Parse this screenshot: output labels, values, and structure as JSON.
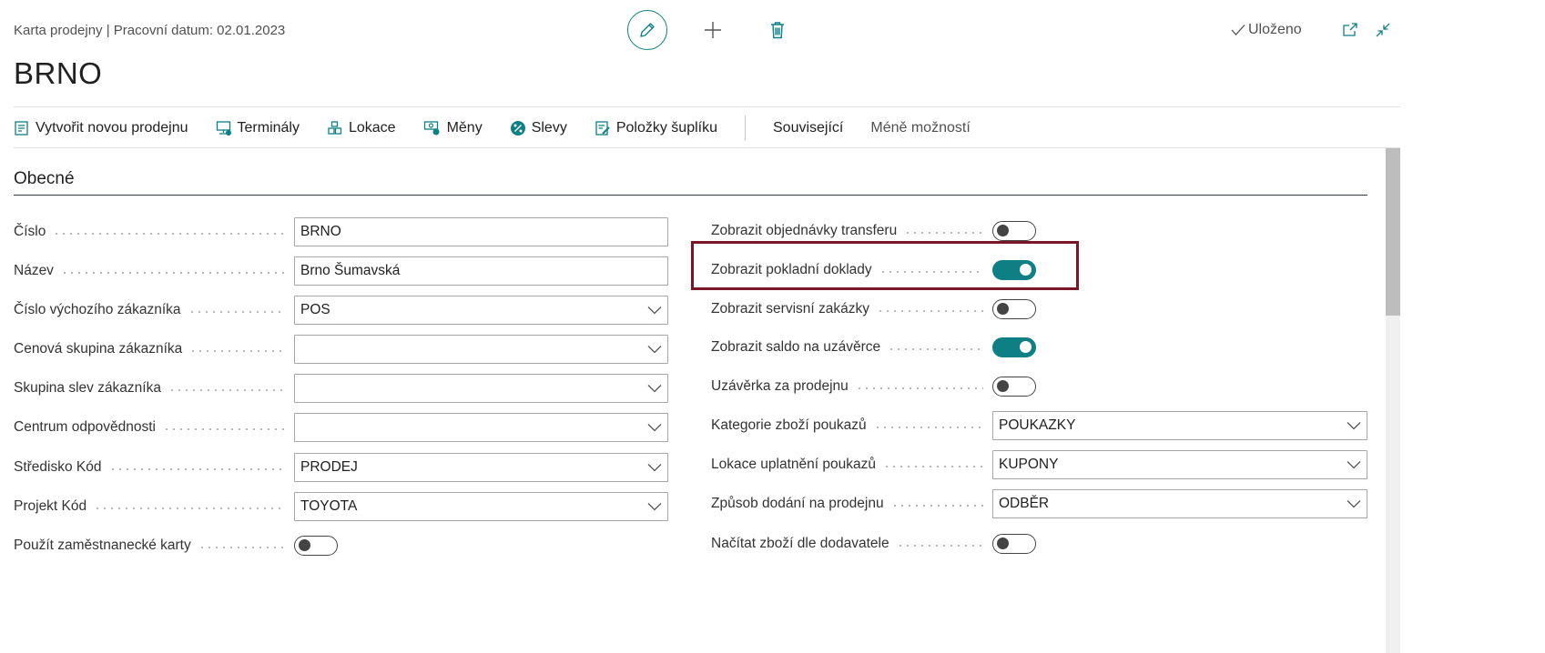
{
  "header": {
    "breadcrumb": "Karta prodejny | Pracovní datum: 02.01.2023",
    "title": "BRNO",
    "saved_label": "Uloženo"
  },
  "actions": [
    {
      "label": "Vytvořit novou prodejnu",
      "icon": "create-store-icon"
    },
    {
      "label": "Terminály",
      "icon": "terminal-icon"
    },
    {
      "label": "Lokace",
      "icon": "location-icon"
    },
    {
      "label": "Měny",
      "icon": "currency-icon"
    },
    {
      "label": "Slevy",
      "icon": "discount-icon"
    },
    {
      "label": "Položky šuplíku",
      "icon": "drawer-items-icon"
    }
  ],
  "more_actions": {
    "related": "Související",
    "fewer": "Méně možností"
  },
  "section": {
    "title": "Obecné"
  },
  "left_fields": [
    {
      "label": "Číslo",
      "type": "text",
      "value": "BRNO"
    },
    {
      "label": "Název",
      "type": "text",
      "value": "Brno Šumavská"
    },
    {
      "label": "Číslo výchozího zákazníka",
      "type": "select",
      "value": "POS"
    },
    {
      "label": "Cenová skupina zákazníka",
      "type": "select",
      "value": ""
    },
    {
      "label": "Skupina slev zákazníka",
      "type": "select",
      "value": ""
    },
    {
      "label": "Centrum odpovědnosti",
      "type": "select",
      "value": ""
    },
    {
      "label": "Středisko Kód",
      "type": "select",
      "value": "PRODEJ"
    },
    {
      "label": "Projekt Kód",
      "type": "select",
      "value": "TOYOTA"
    },
    {
      "label": "Použít zaměstnanecké karty",
      "type": "toggle",
      "value": false
    }
  ],
  "right_fields": [
    {
      "label": "Zobrazit objednávky transferu",
      "type": "toggle",
      "value": false
    },
    {
      "label": "Zobrazit pokladní doklady",
      "type": "toggle",
      "value": true
    },
    {
      "label": "Zobrazit servisní zakázky",
      "type": "toggle",
      "value": false
    },
    {
      "label": "Zobrazit saldo na uzávěrce",
      "type": "toggle",
      "value": true
    },
    {
      "label": "Uzávěrka za prodejnu",
      "type": "toggle",
      "value": false
    },
    {
      "label": "Kategorie zboží poukazů",
      "type": "select",
      "value": "POUKAZKY"
    },
    {
      "label": "Lokace uplatnění poukazů",
      "type": "select",
      "value": "KUPONY"
    },
    {
      "label": "Způsob dodání na prodejnu",
      "type": "select",
      "value": "ODBĚR"
    },
    {
      "label": "Načítat zboží dle dodavatele",
      "type": "toggle",
      "value": false
    }
  ],
  "colors": {
    "accent": "#0f7f86",
    "highlight_border": "#7a1626"
  }
}
